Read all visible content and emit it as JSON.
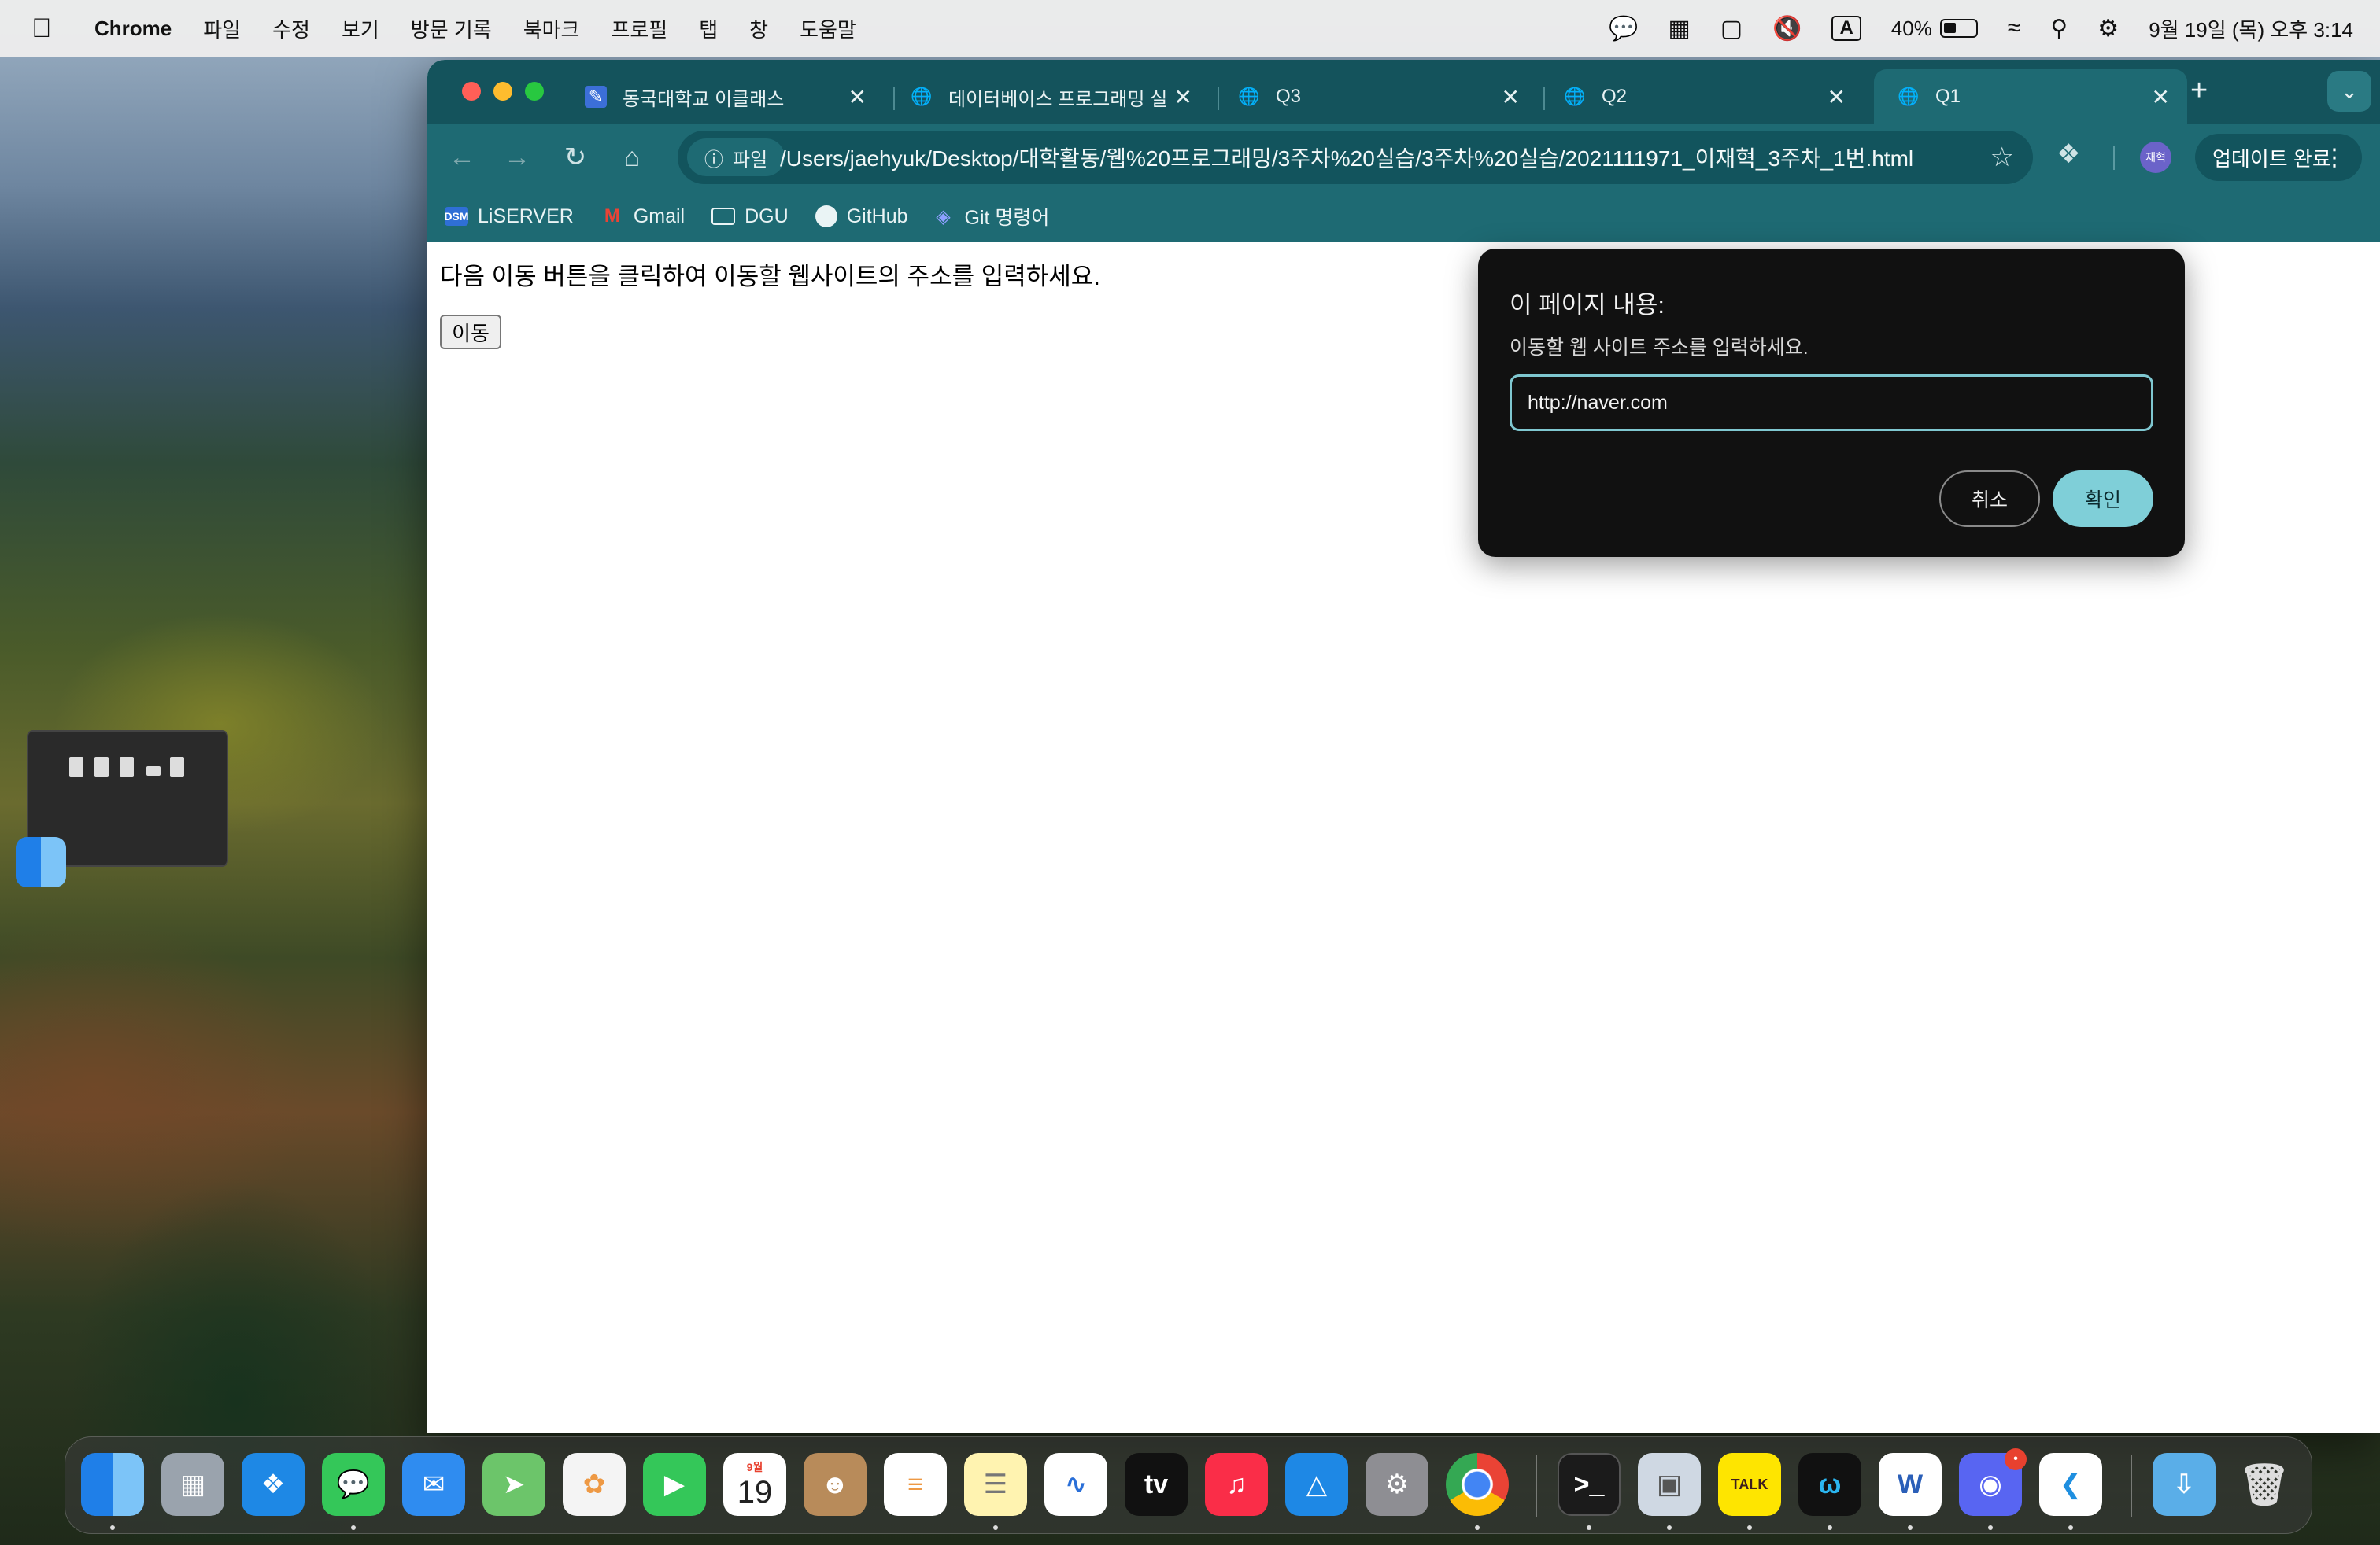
{
  "menubar": {
    "app_name": "Chrome",
    "items": [
      "파일",
      "수정",
      "보기",
      "방문 기록",
      "북마크",
      "프로필",
      "탭",
      "창",
      "도움말"
    ],
    "battery_percent": "40%",
    "battery_level": 0.4,
    "input_indicator": "A",
    "datetime": "9월 19일 (목) 오후 3:14",
    "status_icons": [
      "messages-icon",
      "keyboard-icon",
      "display-icon",
      "muted-icon",
      "input-source-icon",
      "battery-icon",
      "wifi-icon",
      "search-icon",
      "control-center-icon"
    ]
  },
  "browser": {
    "tabs": [
      {
        "title": "동국대학교 이클래스",
        "icon": "eclass-icon",
        "active": false
      },
      {
        "title": "데이터베이스 프로그래밍 실",
        "icon": "globe-icon",
        "active": false
      },
      {
        "title": "Q3",
        "icon": "globe-icon",
        "active": false
      },
      {
        "title": "Q2",
        "icon": "globe-icon",
        "active": false
      },
      {
        "title": "Q1",
        "icon": "globe-icon",
        "active": true
      }
    ],
    "omnibox": {
      "chip_label": "파일",
      "url": "/Users/jaehyuk/Desktop/대학활동/웹%20프로그래밍/3주차%20실습/3주차%20실습/2021111971_이재혁_3주차_1번.html"
    },
    "profile_label": "재혁",
    "update_label": "업데이트 완료",
    "bookmarks": [
      {
        "label": "LiSERVER",
        "icon": "dsm-icon",
        "badge": "DSM"
      },
      {
        "label": "Gmail",
        "icon": "gmail-icon",
        "badge": "M"
      },
      {
        "label": "DGU",
        "icon": "folder-icon",
        "badge": ""
      },
      {
        "label": "GitHub",
        "icon": "github-icon",
        "badge": ""
      },
      {
        "label": "Git 명령어",
        "icon": "git-icon",
        "badge": ""
      }
    ]
  },
  "page": {
    "instruction_text": "다음 이동 버튼을 클릭하여 이동할 웹사이트의 주소를 입력하세요.",
    "move_button_label": "이동"
  },
  "dialog": {
    "title": "이 페이지 내용:",
    "message": "이동할 웹 사이트 주소를 입력하세요.",
    "input_value": "http://naver.com",
    "cancel_label": "취소",
    "ok_label": "확인"
  },
  "dock": {
    "apps": [
      "Finder",
      "Launchpad",
      "Safari",
      "Messages",
      "Mail",
      "Maps",
      "Photos",
      "FaceTime",
      "Calendar",
      "Contacts",
      "Reminders",
      "Notes",
      "Freeform",
      "TV",
      "Music",
      "App Store",
      "System Settings",
      "Chrome",
      "Terminal",
      "Preview",
      "KakaoTalk",
      "Webex",
      "Word",
      "Discord",
      "VS Code",
      "Downloads",
      "Trash"
    ],
    "calendar_month": "9월",
    "calendar_day": "19",
    "tv_label": "tv",
    "kakao_label": "TALK",
    "word_label": "W",
    "discord_badge": "•"
  }
}
